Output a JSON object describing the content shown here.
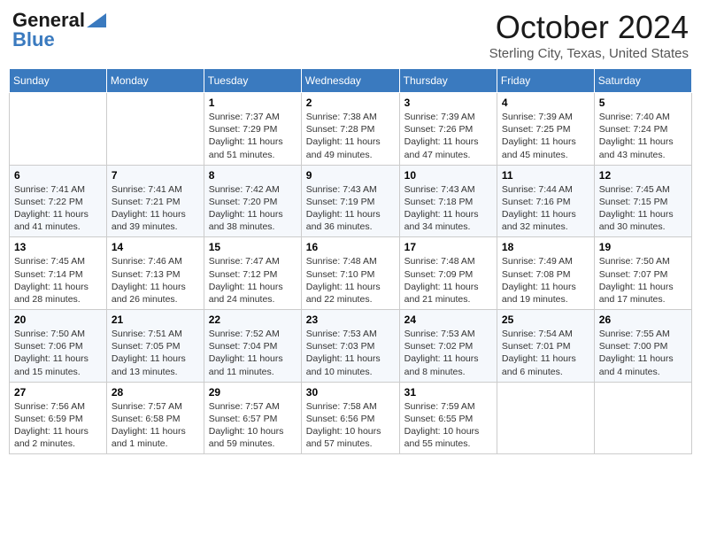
{
  "header": {
    "logo_line1": "General",
    "logo_line2": "Blue",
    "month_title": "October 2024",
    "location": "Sterling City, Texas, United States"
  },
  "weekdays": [
    "Sunday",
    "Monday",
    "Tuesday",
    "Wednesday",
    "Thursday",
    "Friday",
    "Saturday"
  ],
  "weeks": [
    [
      {
        "day": "",
        "info": ""
      },
      {
        "day": "",
        "info": ""
      },
      {
        "day": "1",
        "info": "Sunrise: 7:37 AM\nSunset: 7:29 PM\nDaylight: 11 hours and 51 minutes."
      },
      {
        "day": "2",
        "info": "Sunrise: 7:38 AM\nSunset: 7:28 PM\nDaylight: 11 hours and 49 minutes."
      },
      {
        "day": "3",
        "info": "Sunrise: 7:39 AM\nSunset: 7:26 PM\nDaylight: 11 hours and 47 minutes."
      },
      {
        "day": "4",
        "info": "Sunrise: 7:39 AM\nSunset: 7:25 PM\nDaylight: 11 hours and 45 minutes."
      },
      {
        "day": "5",
        "info": "Sunrise: 7:40 AM\nSunset: 7:24 PM\nDaylight: 11 hours and 43 minutes."
      }
    ],
    [
      {
        "day": "6",
        "info": "Sunrise: 7:41 AM\nSunset: 7:22 PM\nDaylight: 11 hours and 41 minutes."
      },
      {
        "day": "7",
        "info": "Sunrise: 7:41 AM\nSunset: 7:21 PM\nDaylight: 11 hours and 39 minutes."
      },
      {
        "day": "8",
        "info": "Sunrise: 7:42 AM\nSunset: 7:20 PM\nDaylight: 11 hours and 38 minutes."
      },
      {
        "day": "9",
        "info": "Sunrise: 7:43 AM\nSunset: 7:19 PM\nDaylight: 11 hours and 36 minutes."
      },
      {
        "day": "10",
        "info": "Sunrise: 7:43 AM\nSunset: 7:18 PM\nDaylight: 11 hours and 34 minutes."
      },
      {
        "day": "11",
        "info": "Sunrise: 7:44 AM\nSunset: 7:16 PM\nDaylight: 11 hours and 32 minutes."
      },
      {
        "day": "12",
        "info": "Sunrise: 7:45 AM\nSunset: 7:15 PM\nDaylight: 11 hours and 30 minutes."
      }
    ],
    [
      {
        "day": "13",
        "info": "Sunrise: 7:45 AM\nSunset: 7:14 PM\nDaylight: 11 hours and 28 minutes."
      },
      {
        "day": "14",
        "info": "Sunrise: 7:46 AM\nSunset: 7:13 PM\nDaylight: 11 hours and 26 minutes."
      },
      {
        "day": "15",
        "info": "Sunrise: 7:47 AM\nSunset: 7:12 PM\nDaylight: 11 hours and 24 minutes."
      },
      {
        "day": "16",
        "info": "Sunrise: 7:48 AM\nSunset: 7:10 PM\nDaylight: 11 hours and 22 minutes."
      },
      {
        "day": "17",
        "info": "Sunrise: 7:48 AM\nSunset: 7:09 PM\nDaylight: 11 hours and 21 minutes."
      },
      {
        "day": "18",
        "info": "Sunrise: 7:49 AM\nSunset: 7:08 PM\nDaylight: 11 hours and 19 minutes."
      },
      {
        "day": "19",
        "info": "Sunrise: 7:50 AM\nSunset: 7:07 PM\nDaylight: 11 hours and 17 minutes."
      }
    ],
    [
      {
        "day": "20",
        "info": "Sunrise: 7:50 AM\nSunset: 7:06 PM\nDaylight: 11 hours and 15 minutes."
      },
      {
        "day": "21",
        "info": "Sunrise: 7:51 AM\nSunset: 7:05 PM\nDaylight: 11 hours and 13 minutes."
      },
      {
        "day": "22",
        "info": "Sunrise: 7:52 AM\nSunset: 7:04 PM\nDaylight: 11 hours and 11 minutes."
      },
      {
        "day": "23",
        "info": "Sunrise: 7:53 AM\nSunset: 7:03 PM\nDaylight: 11 hours and 10 minutes."
      },
      {
        "day": "24",
        "info": "Sunrise: 7:53 AM\nSunset: 7:02 PM\nDaylight: 11 hours and 8 minutes."
      },
      {
        "day": "25",
        "info": "Sunrise: 7:54 AM\nSunset: 7:01 PM\nDaylight: 11 hours and 6 minutes."
      },
      {
        "day": "26",
        "info": "Sunrise: 7:55 AM\nSunset: 7:00 PM\nDaylight: 11 hours and 4 minutes."
      }
    ],
    [
      {
        "day": "27",
        "info": "Sunrise: 7:56 AM\nSunset: 6:59 PM\nDaylight: 11 hours and 2 minutes."
      },
      {
        "day": "28",
        "info": "Sunrise: 7:57 AM\nSunset: 6:58 PM\nDaylight: 11 hours and 1 minute."
      },
      {
        "day": "29",
        "info": "Sunrise: 7:57 AM\nSunset: 6:57 PM\nDaylight: 10 hours and 59 minutes."
      },
      {
        "day": "30",
        "info": "Sunrise: 7:58 AM\nSunset: 6:56 PM\nDaylight: 10 hours and 57 minutes."
      },
      {
        "day": "31",
        "info": "Sunrise: 7:59 AM\nSunset: 6:55 PM\nDaylight: 10 hours and 55 minutes."
      },
      {
        "day": "",
        "info": ""
      },
      {
        "day": "",
        "info": ""
      }
    ]
  ]
}
